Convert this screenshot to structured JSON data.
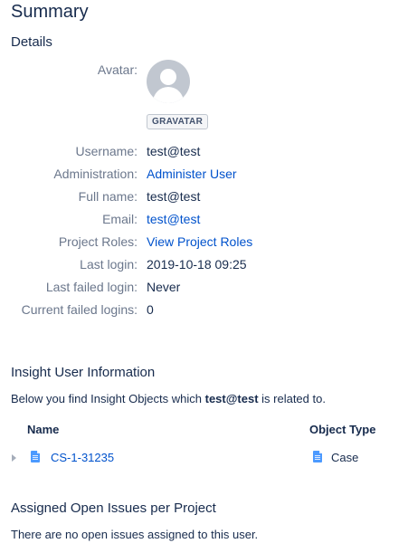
{
  "page_title": "Summary",
  "details": {
    "heading": "Details",
    "avatar_label": "Avatar:",
    "gravatar_label": "GRAVATAR",
    "fields": [
      {
        "label": "Username:",
        "value": "test@test"
      },
      {
        "label": "Administration:",
        "value": "Administer User"
      },
      {
        "label": "Full name:",
        "value": "test@test"
      },
      {
        "label": "Email:",
        "value": "test@test"
      },
      {
        "label": "Project Roles:",
        "value": "View Project Roles"
      },
      {
        "label": "Last login:",
        "value": "2019-10-18 09:25"
      },
      {
        "label": "Last failed login:",
        "value": "Never"
      },
      {
        "label": "Current failed logins:",
        "value": "0"
      }
    ]
  },
  "insight": {
    "heading": "Insight User Information",
    "intro_prefix": "Below you find Insight Objects which ",
    "intro_user": "test@test",
    "intro_suffix": " is related to.",
    "columns": [
      "Name",
      "Object Type"
    ],
    "rows": [
      {
        "name": "CS-1-31235",
        "object_type": "Case",
        "icon": "document-icon"
      }
    ]
  },
  "issues": {
    "heading": "Assigned Open Issues per Project",
    "empty_text": "There are no open issues assigned to this user."
  },
  "colors": {
    "link": "#0052cc",
    "label": "#6b778c",
    "text": "#172b4d"
  }
}
